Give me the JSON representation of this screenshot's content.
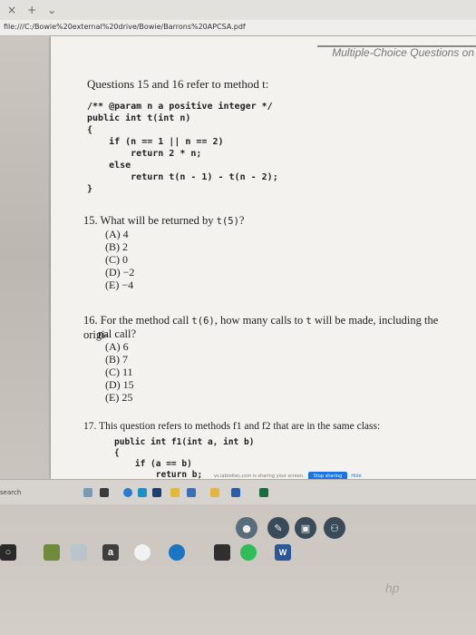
{
  "browser": {
    "tab_close": "×",
    "tab_new": "+",
    "tab_menu": "⌄",
    "url": "file:///C:/Bowie%20external%20drive/Bowie/Barrons%20APCSA.pdf"
  },
  "document": {
    "header": "Multiple-Choice Questions on",
    "heading": "Questions 15 and 16 refer to method t:",
    "code_lines": [
      "/** @param n a positive integer */",
      "public int t(int n)",
      "{",
      "    if (n == 1 || n == 2)",
      "        return 2 * n;",
      "    else",
      "        return t(n - 1) - t(n - 2);",
      "}"
    ],
    "q15": {
      "number": "15.",
      "text_before": "What will be returned by ",
      "code": "t(5)",
      "text_after": "?",
      "choices": [
        "(A) 4",
        "(B) 2",
        "(C) 0",
        "(D) −2",
        "(E) −4"
      ]
    },
    "q16": {
      "number": "16.",
      "line1_before": "For the method call ",
      "code1": "t(6)",
      "line1_mid": ", how many calls to ",
      "code2": "t",
      "line1_after": " will be made, including the origi-",
      "line2": "nal call?",
      "choices": [
        "(A) 6",
        "(B) 7",
        "(C) 11",
        "(D) 15",
        "(E) 25"
      ]
    },
    "q17": {
      "number": "17.",
      "text": "This question refers to methods f1 and f2 that are in the same class:",
      "code_lines": [
        "public int f1(int a, int b)",
        "{",
        "    if (a == b)",
        "        return b;"
      ]
    }
  },
  "sharebar": {
    "text": "vs.labroitec.com is sharing your screen.",
    "stop_label": "Stop sharing",
    "hide_label": "Hide"
  },
  "taskbar": {
    "search_label": "search"
  },
  "dock": {
    "amazon_label": "a",
    "word_label": "W"
  },
  "brand": "hp"
}
